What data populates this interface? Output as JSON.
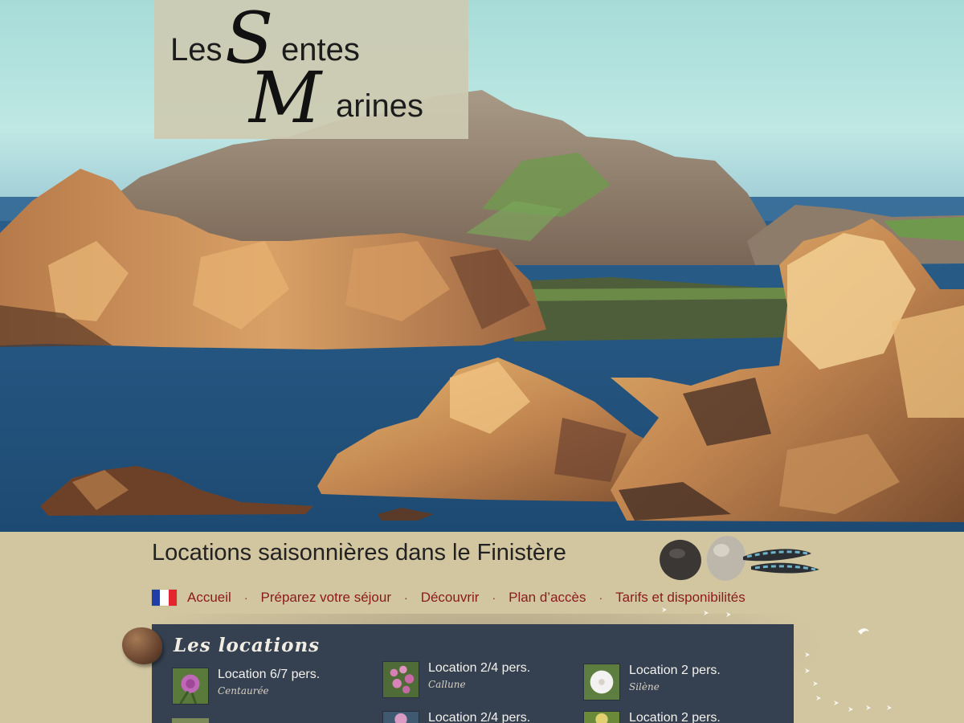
{
  "site": {
    "logo": {
      "les": "Les",
      "s_initial": "S",
      "entes": "entes",
      "m_initial": "M",
      "arines": "arines"
    },
    "tagline": "Locations saisonnières dans le Finistère"
  },
  "nav": {
    "language_flag": "flag-france-icon",
    "items": [
      {
        "label": "Accueil"
      },
      {
        "label": "Préparez votre séjour"
      },
      {
        "label": "Découvrir"
      },
      {
        "label": "Plan d’accès"
      },
      {
        "label": "Tarifs et disponibilités"
      }
    ],
    "separator": "·"
  },
  "locations": {
    "title": "Les locations",
    "items": [
      {
        "name": "Location 6/7 pers.",
        "sub": "Centaurée",
        "thumb": "centauree-flower"
      },
      {
        "name": "Location 2/4 pers.",
        "sub": "Callune",
        "thumb": "callune-flower"
      },
      {
        "name": "Location 2 pers.",
        "sub": "Silène",
        "thumb": "silene-flower"
      },
      {
        "name": "Location 2/4 pers.",
        "sub": "",
        "thumb": "flower"
      },
      {
        "name": "Location 2 pers.",
        "sub": "",
        "thumb": "flower"
      }
    ]
  },
  "colors": {
    "background": "#d2c6a1",
    "panel": "#354050",
    "nav_link": "#8b1a1a",
    "logo_panel": "#cdcab2"
  }
}
